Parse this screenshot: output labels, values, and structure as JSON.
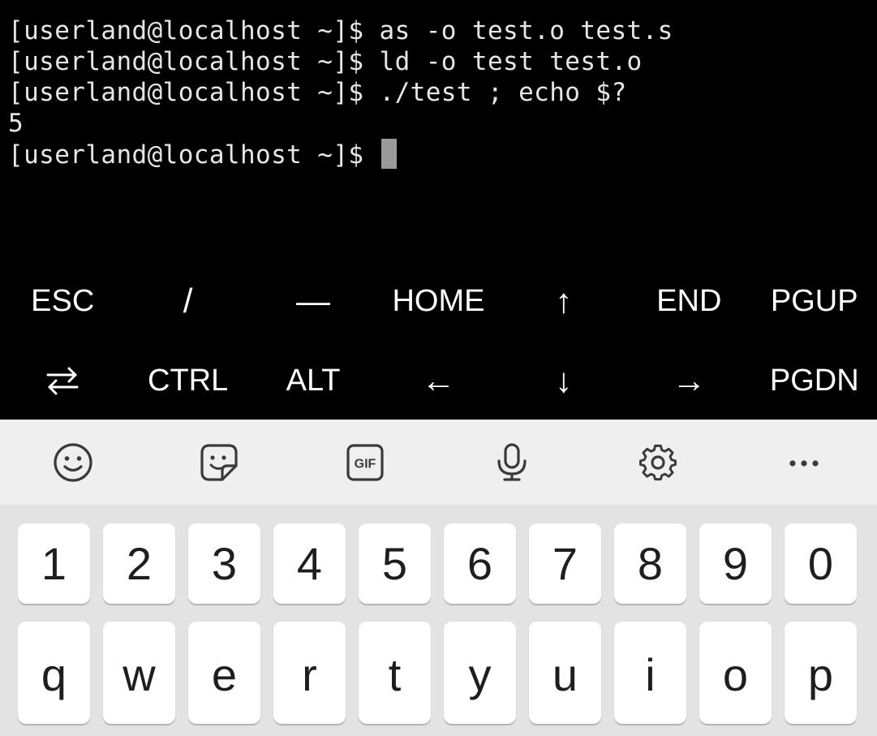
{
  "terminal": {
    "lines": [
      {
        "prompt": "[userland@localhost ~]$ ",
        "command": "as -o test.o test.s"
      },
      {
        "prompt": "[userland@localhost ~]$ ",
        "command": "ld -o test test.o"
      },
      {
        "prompt": "[userland@localhost ~]$ ",
        "command": "./test ; echo $?"
      },
      {
        "output": "5"
      },
      {
        "prompt": "[userland@localhost ~]$ ",
        "command": ""
      }
    ]
  },
  "extra_keys": {
    "row1": [
      "ESC",
      "/",
      "—",
      "HOME",
      "↑",
      "END",
      "PGUP"
    ],
    "row2": [
      "⇄",
      "CTRL",
      "ALT",
      "←",
      "↓",
      "→",
      "PGDN"
    ],
    "row2_icon": "swap-arrows-icon"
  },
  "toolbar": {
    "icons": [
      "emoji-icon",
      "sticker-icon",
      "gif-icon",
      "microphone-icon",
      "settings-gear-icon",
      "more-options-icon"
    ],
    "gif_label": "GIF"
  },
  "keyboard": {
    "number_row": [
      "1",
      "2",
      "3",
      "4",
      "5",
      "6",
      "7",
      "8",
      "9",
      "0"
    ],
    "letter_row": [
      "q",
      "w",
      "e",
      "r",
      "t",
      "y",
      "u",
      "i",
      "o",
      "p"
    ]
  },
  "colors": {
    "terminal_bg": "#000000",
    "terminal_text": "#e6e6e6",
    "cursor": "#9a9a9a",
    "toolbar_bg": "#efefef",
    "keyboard_bg": "#e3e3e3",
    "key_bg": "#ffffff"
  }
}
